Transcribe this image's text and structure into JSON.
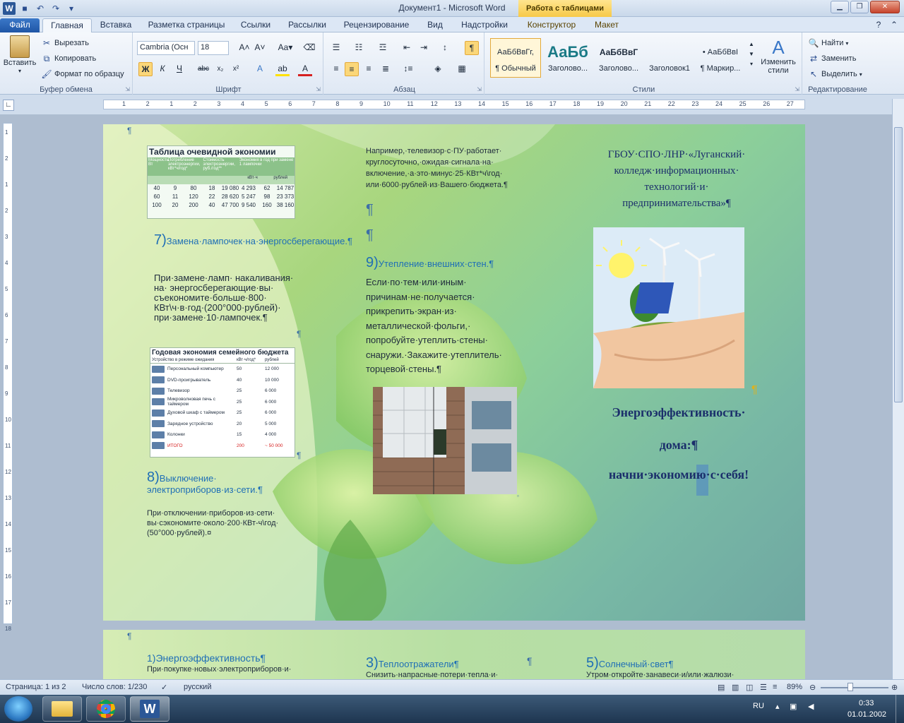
{
  "window": {
    "title": "Документ1 - Microsoft Word",
    "context_tab_group": "Работа с таблицами"
  },
  "tabs": [
    "Файл",
    "Главная",
    "Вставка",
    "Разметка страницы",
    "Ссылки",
    "Рассылки",
    "Рецензирование",
    "Вид",
    "Надстройки",
    "Конструктор",
    "Макет"
  ],
  "ribbon": {
    "clipboard": {
      "paste": "Вставить",
      "cut": "Вырезать",
      "copy": "Копировать",
      "format_painter": "Формат по образцу",
      "label": "Буфер обмена"
    },
    "font": {
      "name": "Cambria (Осн",
      "size": "18",
      "label": "Шрифт"
    },
    "paragraph": {
      "label": "Абзац"
    },
    "styles": {
      "label": "Стили",
      "items": [
        {
          "preview": "АаБбВвГг,",
          "name": "¶ Обычный"
        },
        {
          "preview": "АаБб",
          "name": "Заголово..."
        },
        {
          "preview": "АаБбВвГ",
          "name": "Заголово..."
        },
        {
          "preview": "",
          "name": "Заголовок1"
        },
        {
          "preview": "• АаБбВвІ",
          "name": "¶ Маркир..."
        }
      ],
      "change": "Изменить стили"
    },
    "editing": {
      "find": "Найти",
      "replace": "Заменить",
      "select": "Выделить",
      "label": "Редактирование"
    }
  },
  "ruler": {
    "numbers": [
      "1",
      "2",
      "1",
      "2",
      "3",
      "4",
      "5",
      "6",
      "7",
      "8",
      "9",
      "10",
      "11",
      "12",
      "13",
      "14",
      "15",
      "16",
      "17",
      "18",
      "19",
      "20",
      "21",
      "22",
      "23",
      "24",
      "25",
      "26",
      "27"
    ],
    "vnumbers": [
      "1",
      "2",
      "1",
      "2",
      "3",
      "4",
      "5",
      "6",
      "7",
      "8",
      "9",
      "10",
      "11",
      "12",
      "13",
      "14",
      "15",
      "16",
      "17",
      "18"
    ]
  },
  "page1": {
    "table1_title": "Таблица очевидной экономии",
    "table1_headers": [
      "Мощность, Вт",
      "Потребление электроэнергии, кВт*ч/год*",
      "Стоимость электроэнергии, руб./год**",
      "Экономия в год при замене 1 лампочки"
    ],
    "table1_subheaders": [
      "кВт·ч",
      "рублей"
    ],
    "table1_rows": [
      [
        "40",
        "9",
        "80",
        "18",
        "19 080",
        "4 293",
        "62",
        "14 787"
      ],
      [
        "60",
        "11",
        "120",
        "22",
        "28 620",
        "5 247",
        "98",
        "23 373"
      ],
      [
        "100",
        "20",
        "200",
        "40",
        "47 700",
        "9 540",
        "160",
        "38 160"
      ]
    ],
    "s7_num": "7)",
    "s7_title": "Замена·лампочек·на·энергосберегающие.¶",
    "s7_body": "При·замене·ламп· накаливания· на· энергосберегающие·вы· съекономите·больше·800· КВт\\ч·в·год·(200°000·рублей)· при·замене·10·лампочек.¶",
    "table2_title": "Годовая экономия семейного бюджета",
    "table2_headers": [
      "Устройство в режиме ожидания",
      "кВт·ч/год*",
      "рублей"
    ],
    "table2_rows": [
      [
        "Персональный компьютер",
        "50",
        "12 000"
      ],
      [
        "DVD-проигрыватель",
        "40",
        "10 000"
      ],
      [
        "Телевизор",
        "25",
        "6 000"
      ],
      [
        "Микроволновая печь с таймером",
        "25",
        "6 000"
      ],
      [
        "Духовой шкаф с таймером",
        "25",
        "6 000"
      ],
      [
        "Зарядное устройство",
        "20",
        "5 000"
      ],
      [
        "Колонки",
        "15",
        "4 000"
      ],
      [
        "ИТОГО",
        "200",
        "~ 50 000"
      ]
    ],
    "s8_num": "8)",
    "s8_title": "Выключение· электроприборов·из·сети.¶",
    "s8_body": "При·отключении·приборов·из·сети· вы·сэкономите·около·200·КВт-ч\\год· (50°000·рублей).¤",
    "col2_top": "Например,·телевизор·с·ПУ·работает· круглосуточно,·ожидая·сигнала·на· включение,·а·это·минус·25·КВт*ч\\год· или·6000·рублей·из·Вашего·бюджета.¶",
    "para_mark": "¶",
    "s9_num": "9)",
    "s9_title": "Утепление·внешних·стен.¶",
    "s9_body": "Если·по·тем·или·иным· причинам·не·получается· прикрепить·экран·из· металлической·фольги,· попробуйте·утеплить·стены· снаружи.·Закажите·утеплитель· торцевой·стены.¶",
    "college": "ГБОУ·СПО·ЛНР·«Луганский· колледж·информационных· технологий·и· предпринимательства»¶",
    "headline1": "Энергоэффективность·",
    "headline2": "дома:¶",
    "headline3": "начни·экономию·с·себя!"
  },
  "page2": {
    "s1": "1)Энергоэффективность¶",
    "s1_body": "При·покупке·новых·электроприборов·и·",
    "s3_num": "3)",
    "s3": "Теплоотражатели¶",
    "s3_body": "Снизить·напрасные·потери·тепла·и·",
    "s5_num": "5)",
    "s5": "Солнечный·свет¶",
    "s5_body": "Утром·откройте·занавеси·и/или·жалюзи·"
  },
  "status": {
    "page": "Страница: 1 из 2",
    "words": "Число слов: 1/230",
    "lang": "русский",
    "zoom": "89%"
  },
  "taskbar": {
    "lang": "RU",
    "time": "0:33",
    "date": "01.01.2002"
  },
  "colors": {
    "accent_blue": "#1f6fb6",
    "headline_navy": "#1b2f6b",
    "file_tab": "#2a62b3"
  }
}
